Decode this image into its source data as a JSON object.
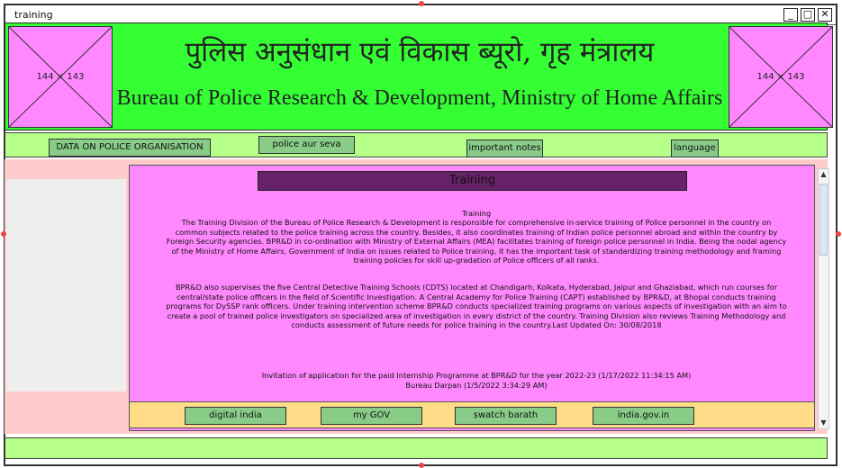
{
  "window": {
    "title": "training",
    "controls": {
      "minimize": "_",
      "maximize": "□",
      "close": "✕"
    }
  },
  "header": {
    "left_placeholder": "144 × 143",
    "right_placeholder": "144 × 143",
    "title_hindi": "पुलिस अनुसंधान एवं विकास ब्यूरो, गृह मंत्रालय",
    "title_english": "Bureau of Police Research & Development, Ministry of Home Affairs"
  },
  "nav": {
    "items": [
      {
        "label": "DATA ON POLICE ORGANISATION"
      },
      {
        "label": "police aur seva"
      },
      {
        "label": "important notes"
      },
      {
        "label": "language"
      }
    ]
  },
  "content": {
    "title": "Training",
    "paragraph1_heading": "Training",
    "paragraph1": "The Training Division of the Bureau of Police Research & Development is responsible for comprehensive in-service training of Police personnel in the country on common subjects related to the police training across the country. Besides, it also coordinates training of Indian police personnel abroad and within the country by Foreign Security agencies. BPR&D in co-ordination with Ministry of External Affairs (MEA) facilitates training of foreign police personnel in India. Being the nodal agency of the Ministry of Home Affairs, Government of India on issues related to Police training, it has the important task of standardizing training methodology and framing training policies for skill up-gradation of Police officers of all ranks.",
    "paragraph2": "BPR&D also supervises the five Central Detective Training Schools (CDTS) located at Chandigarh, Kolkata, Hyderabad, Jaipur and Ghaziabad, which run courses for central/state police officers in the field of Scientific Investigation. A Central Academy for Police Training (CAPT) established by BPR&D, at Bhopal conducts training programs for DySSP rank officers. Under training intervention scheme BPR&D conducts specialized training programs on various aspects of investigation with an aim to create a pool of trained police investigators on specialized area of investigation in every district of the country. Training Division also reviews Training Methodology and conducts assessment of future needs for police training in the country.Last Updated On: 30/08/2018",
    "notice1": "Invitation of application for the paid Internship Programme at BPR&D for the year 2022-23 (1/17/2022 11:34:15 AM)",
    "notice2": "Bureau Darpan (1/5/2022 3:34:29 AM)"
  },
  "footer": {
    "links": [
      {
        "label": "digital india"
      },
      {
        "label": "my GOV"
      },
      {
        "label": "swatch barath"
      },
      {
        "label": "india.gov.in"
      }
    ]
  },
  "scrollbar": {
    "up": "▲",
    "down": "▼"
  },
  "colors": {
    "header_bg": "#33ff33",
    "placeholder_bg": "#ff88ff",
    "nav_bg": "#b6ff88",
    "button_bg": "#88cc88",
    "page_bg": "#ffcccc",
    "content_bg": "#ff88ff",
    "title_bar_bg": "#662266",
    "footer_bg": "#ffdd88"
  }
}
